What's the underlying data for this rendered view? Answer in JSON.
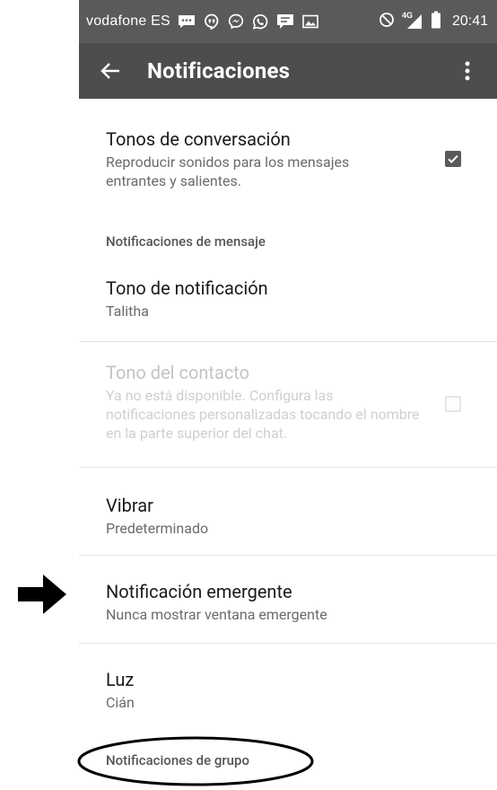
{
  "status_bar": {
    "carrier": "vodafone ES",
    "network": "4G",
    "time": "20:41",
    "left_icons": [
      "message-icon",
      "hangouts-icon",
      "messenger-icon",
      "whatsapp-icon",
      "chat-icon",
      "image-icon"
    ],
    "right_icons": [
      "block-icon",
      "signal-icon",
      "battery-icon"
    ]
  },
  "app_bar": {
    "title": "Notificaciones"
  },
  "settings": {
    "conversation_tones": {
      "title": "Tonos de conversación",
      "summary": "Reproducir sonidos para los mensajes entrantes y salientes.",
      "checked": true
    },
    "message_section_header": "Notificaciones de mensaje",
    "notification_tone": {
      "title": "Tono de notificación",
      "summary": "Talitha"
    },
    "contact_tone": {
      "title": "Tono del contacto",
      "summary": "Ya no está disponible. Configura las notificaciones personalizadas tocando el nombre en la parte superior del chat.",
      "checked": false,
      "enabled": false
    },
    "vibrate": {
      "title": "Vibrar",
      "summary": "Predeterminado"
    },
    "popup_notification": {
      "title": "Notificación emergente",
      "summary": "Nunca mostrar ventana emergente"
    },
    "light": {
      "title": "Luz",
      "summary": "Cián"
    },
    "group_section_header": "Notificaciones de grupo"
  },
  "colors": {
    "status_bar": "#5a5a5a",
    "app_bar": "#4d4d4d",
    "checkbox_checked": "#5a5a5a",
    "annotation": "#000000"
  }
}
